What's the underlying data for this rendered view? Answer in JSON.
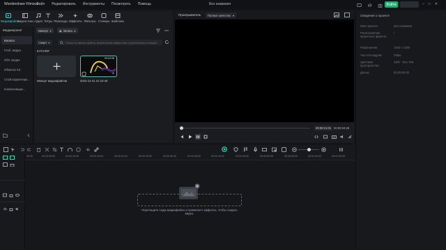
{
  "app": {
    "title": "Wondershare Filmoca",
    "menu": [
      "Файл",
      "Редактировать",
      "Инструменты",
      "Посмотреть",
      "Помощь"
    ],
    "doc_title": "Без названия",
    "export_label": "Войти",
    "account_label": ""
  },
  "media_toolbar": {
    "items": [
      {
        "label": "Медиафайлы",
        "active": true
      },
      {
        "label": "Видеостоки"
      },
      {
        "label": "Аудио"
      },
      {
        "label": "Титры"
      },
      {
        "label": "Переходы"
      },
      {
        "label": "Эффекты"
      },
      {
        "label": "Фильтры"
      },
      {
        "label": "Стикеры"
      },
      {
        "label": "Шаблоны"
      }
    ]
  },
  "sidebar": {
    "header": "Медиапроект",
    "items": [
      {
        "label": "Каталог",
        "selected": true
      },
      {
        "label": "Глоб. медиа"
      },
      {
        "label": "Обл. медиа"
      },
      {
        "label": "Influence Kit"
      },
      {
        "label": "Слой корректиро..."
      },
      {
        "label": "Компоновщик..."
      }
    ]
  },
  "media": {
    "import_chip": "Импорт",
    "record_chip": "Запись",
    "sort_chip": "Смарт",
    "search_placeholder": "Поиск по имени файла, визуальным эффектам и длительности медиа",
    "folder_label": "КАТАЛОГ",
    "import_tile_label": "Импорт медиафайлов",
    "clip_label": "2024-12-31 21-23-40",
    "clip_duration": "00:04:28"
  },
  "player": {
    "label": "Проигрыватель",
    "quality": "Полное качество",
    "time_current": "00:00:21:01",
    "time_total": "00:00:04:28"
  },
  "properties": {
    "title": "Сведения о проекте",
    "rows": [
      {
        "key": "Имя проекта:",
        "value": "Без названия"
      },
      {
        "key": "Расположение проектных файлов:",
        "value": "/"
      },
      {
        "key": "Разрешение:",
        "value": "1920 x 1080"
      },
      {
        "key": "Частота кадров:",
        "value": "25fps"
      },
      {
        "key": "Цветовое пространство:",
        "value": "SDR - Rec.709"
      },
      {
        "key": "Длина:",
        "value": "00:00:00:00"
      }
    ]
  },
  "timeline": {
    "ticks": [
      "00:00",
      "00:00:05:00",
      "00:00:10:00",
      "00:00:15:00",
      "00:00:20:00",
      "00:00:25:00",
      "00:00:30:00",
      "00:00:35:00",
      "00:00:40:00",
      "00:00:45:00",
      "00:00:50:00",
      "00:00:55:00",
      "00:01:00:00",
      "00:01:05:00"
    ],
    "drop_text": "Перетащите сюда медиафайлы и примените эффекты, чтобы создать видео."
  },
  "colors": {
    "accent": "#2fd5d9",
    "export": "#1fae74",
    "clip_border": "#2fd5b0"
  }
}
